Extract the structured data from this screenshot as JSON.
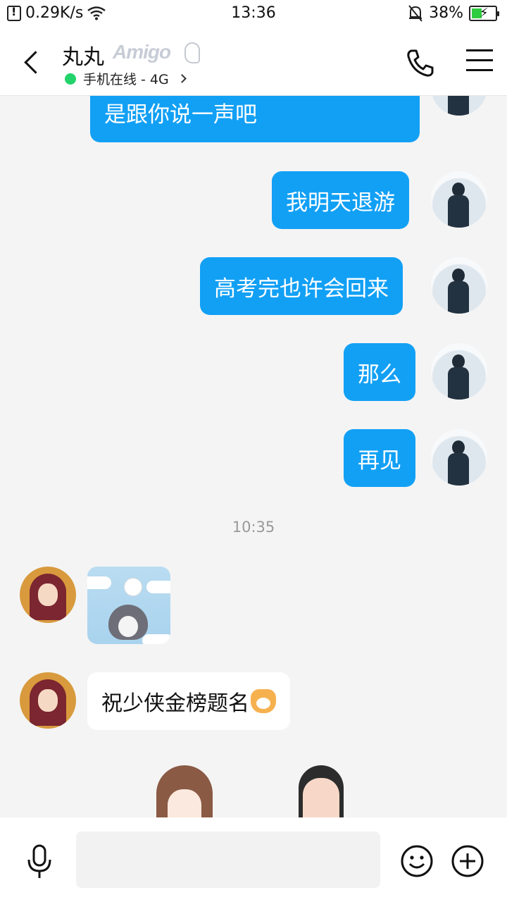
{
  "status_bar": {
    "network_speed": "0.29K/s",
    "time": "13:36",
    "battery_percent": "38%"
  },
  "header": {
    "contact_name": "丸丸",
    "badge_text": "Amigo",
    "online_status": "手机在线 - 4G",
    "status_color": "#22d36b"
  },
  "messages": {
    "partial_top": "是跟你说一声吧",
    "m1": "我明天退游",
    "m2": "高考完也许会回来",
    "m3": "那么",
    "m4": "再见",
    "timestamp": "10:35",
    "reply": "祝少侠金榜题名"
  },
  "colors": {
    "outgoing_bubble": "#12a0f5",
    "incoming_bubble": "#ffffff",
    "background": "#f4f4f4"
  },
  "icons": {
    "back": "back-arrow-icon",
    "phone": "phone-icon",
    "menu": "menu-icon",
    "mic": "microphone-icon",
    "emoji": "smiley-icon",
    "plus": "plus-icon"
  },
  "input": {
    "placeholder": "",
    "value": ""
  }
}
